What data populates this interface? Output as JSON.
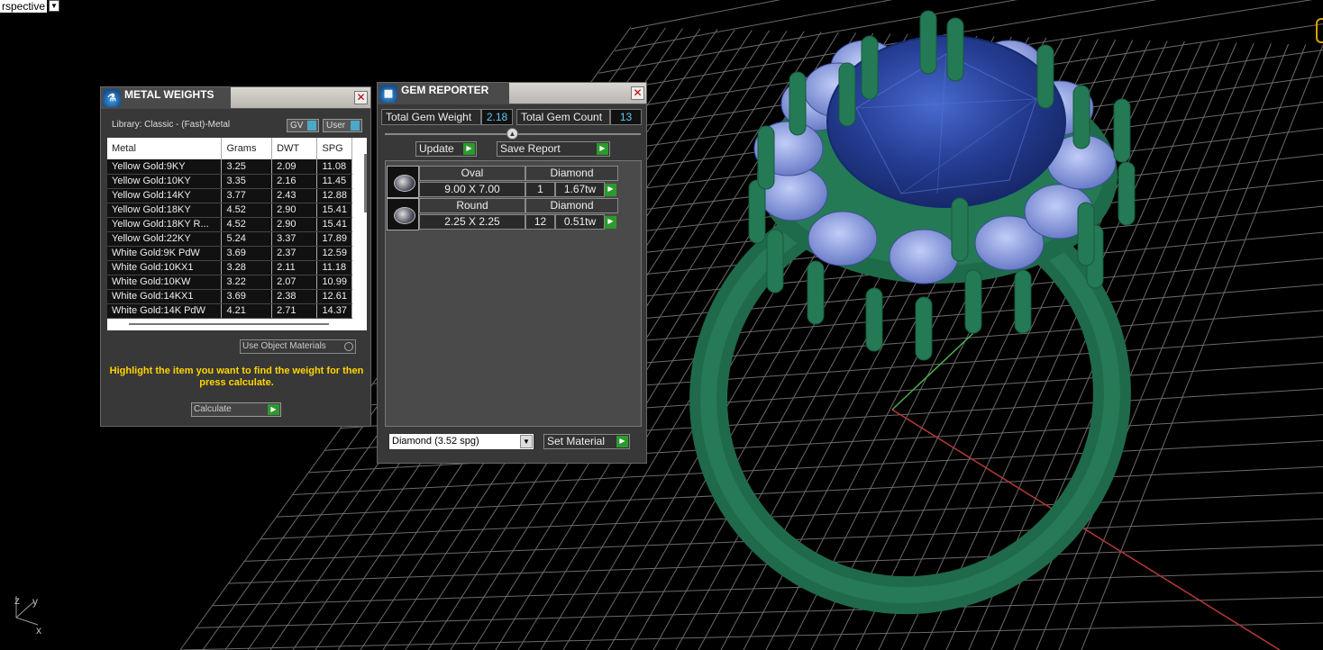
{
  "viewport": {
    "label": "rspective",
    "axis_labels": {
      "z": "z",
      "y": "y",
      "x": "x"
    }
  },
  "metal_weights": {
    "title": "METAL WEIGHTS",
    "library": "Library: Classic - (Fast)-Metal",
    "gv_label": "GV",
    "user_label": "User",
    "columns": [
      "Metal",
      "Grams",
      "DWT",
      "SPG"
    ],
    "rows": [
      [
        "Yellow Gold:9KY",
        "3.25",
        "2.09",
        "11.08"
      ],
      [
        "Yellow Gold:10KY",
        "3.35",
        "2.16",
        "11.45"
      ],
      [
        "Yellow Gold:14KY",
        "3.77",
        "2.43",
        "12.88"
      ],
      [
        "Yellow Gold:18KY",
        "4.52",
        "2.90",
        "15.41"
      ],
      [
        "Yellow Gold:18KY R...",
        "4.52",
        "2.90",
        "15.41"
      ],
      [
        "Yellow Gold:22KY",
        "5.24",
        "3.37",
        "17.89"
      ],
      [
        "White Gold:9K PdW",
        "3.69",
        "2.37",
        "12.59"
      ],
      [
        "White Gold:10KX1",
        "3.28",
        "2.11",
        "11.18"
      ],
      [
        "White Gold:10KW",
        "3.22",
        "2.07",
        "10.99"
      ],
      [
        "White Gold:14KX1",
        "3.69",
        "2.38",
        "12.61"
      ],
      [
        "White Gold:14K PdW",
        "4.21",
        "2.71",
        "14.37"
      ]
    ],
    "use_object_materials": "Use Object Materials",
    "hint": "Highlight the item you want to find the weight for then press calculate.",
    "calculate_label": "Calculate"
  },
  "gem_reporter": {
    "title": "GEM REPORTER",
    "total_weight_label": "Total Gem Weight",
    "total_weight_value": "2.18",
    "total_count_label": "Total Gem Count",
    "total_count_value": "13",
    "update_label": "Update",
    "save_report_label": "Save Report",
    "gems": [
      {
        "shape": "Oval",
        "material": "Diamond",
        "size": "9.00 X 7.00",
        "count": "1",
        "weight": "1.67tw"
      },
      {
        "shape": "Round",
        "material": "Diamond",
        "size": "2.25 X 2.25",
        "count": "12",
        "weight": "0.51tw"
      }
    ],
    "material_select": "Diamond    (3.52 spg)",
    "set_material_label": "Set Material"
  }
}
